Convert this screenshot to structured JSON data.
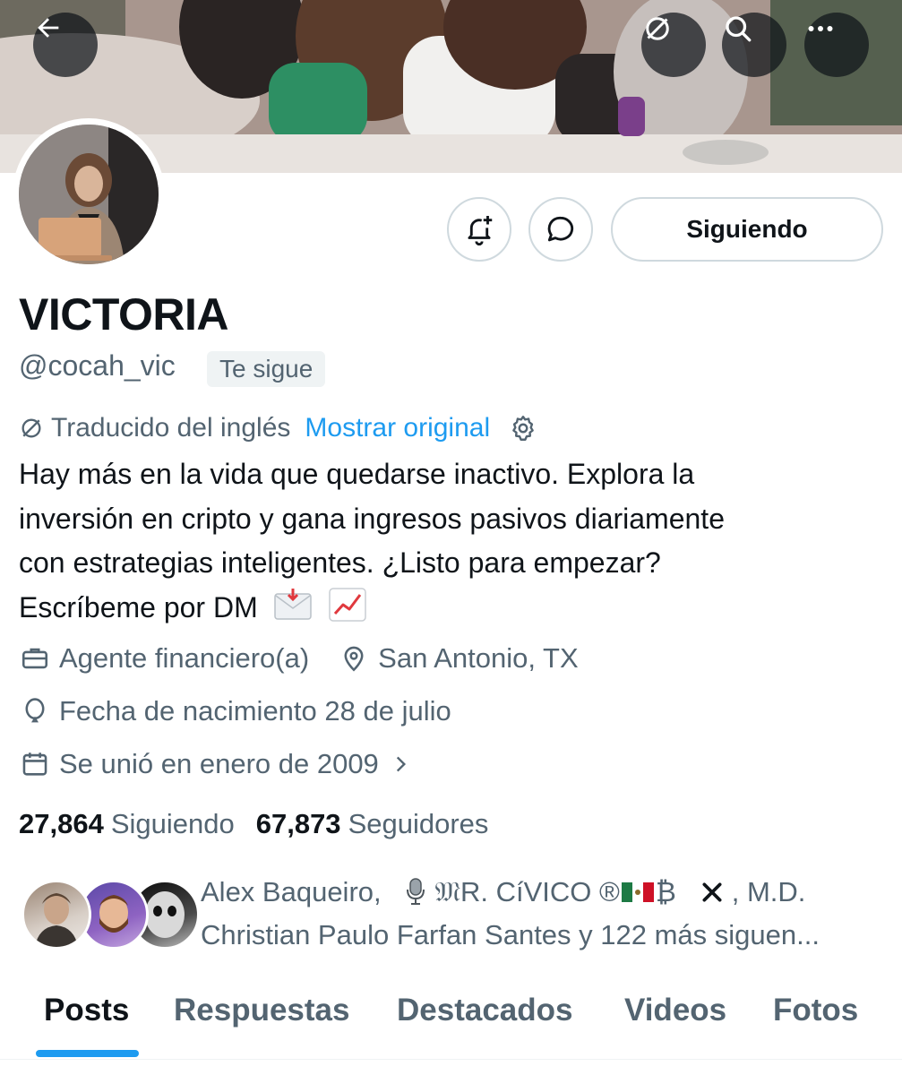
{
  "header": {
    "back_icon": "arrow-left-icon",
    "translate_icon": "translate-off-icon",
    "search_icon": "search-icon",
    "more_icon": "more-horizontal-icon"
  },
  "profile": {
    "name": "VICTORIA",
    "handle": "@cocah_vic",
    "follows_you_badge": "Te sigue",
    "follow_button_label": "Siguiendo"
  },
  "translation": {
    "label": "Traducido del inglés",
    "show_original": "Mostrar original"
  },
  "bio": {
    "lines": [
      "Hay más en la vida que quedarse inactivo. Explora la",
      "inversión en cripto y gana ingresos pasivos diariamente",
      "con estrategias inteligentes. ¿Listo para empezar?",
      "Escríbeme por DM"
    ],
    "emojis": [
      "incoming-envelope-emoji",
      "chart-increasing-emoji"
    ]
  },
  "meta": {
    "profession": "Agente financiero(a)",
    "location": "San Antonio, TX",
    "birthday": "Fecha de nacimiento 28 de julio",
    "joined": "Se unió en enero de 2009"
  },
  "stats": {
    "following_count": "27,864",
    "following_label": "Siguiendo",
    "followers_count": "67,873",
    "followers_label": "Seguidores"
  },
  "followers_you_know": {
    "line1_part1": "Alex Baqueiro,",
    "line1_part2": "𝔐R. CíVICO ®",
    "line1_part3": "₿",
    "line1_part4": ", M.D.",
    "line2": "Christian Paulo Farfan Santes y 122 más siguen..."
  },
  "tabs": [
    {
      "label": "Posts",
      "active": true
    },
    {
      "label": "Respuestas",
      "active": false
    },
    {
      "label": "Destacados",
      "active": false
    },
    {
      "label": "Videos",
      "active": false
    },
    {
      "label": "Fotos",
      "active": false
    }
  ],
  "colors": {
    "accent": "#1d9bf0",
    "text_primary": "#0f1419",
    "text_secondary": "#536471",
    "border": "#cfd9de"
  }
}
